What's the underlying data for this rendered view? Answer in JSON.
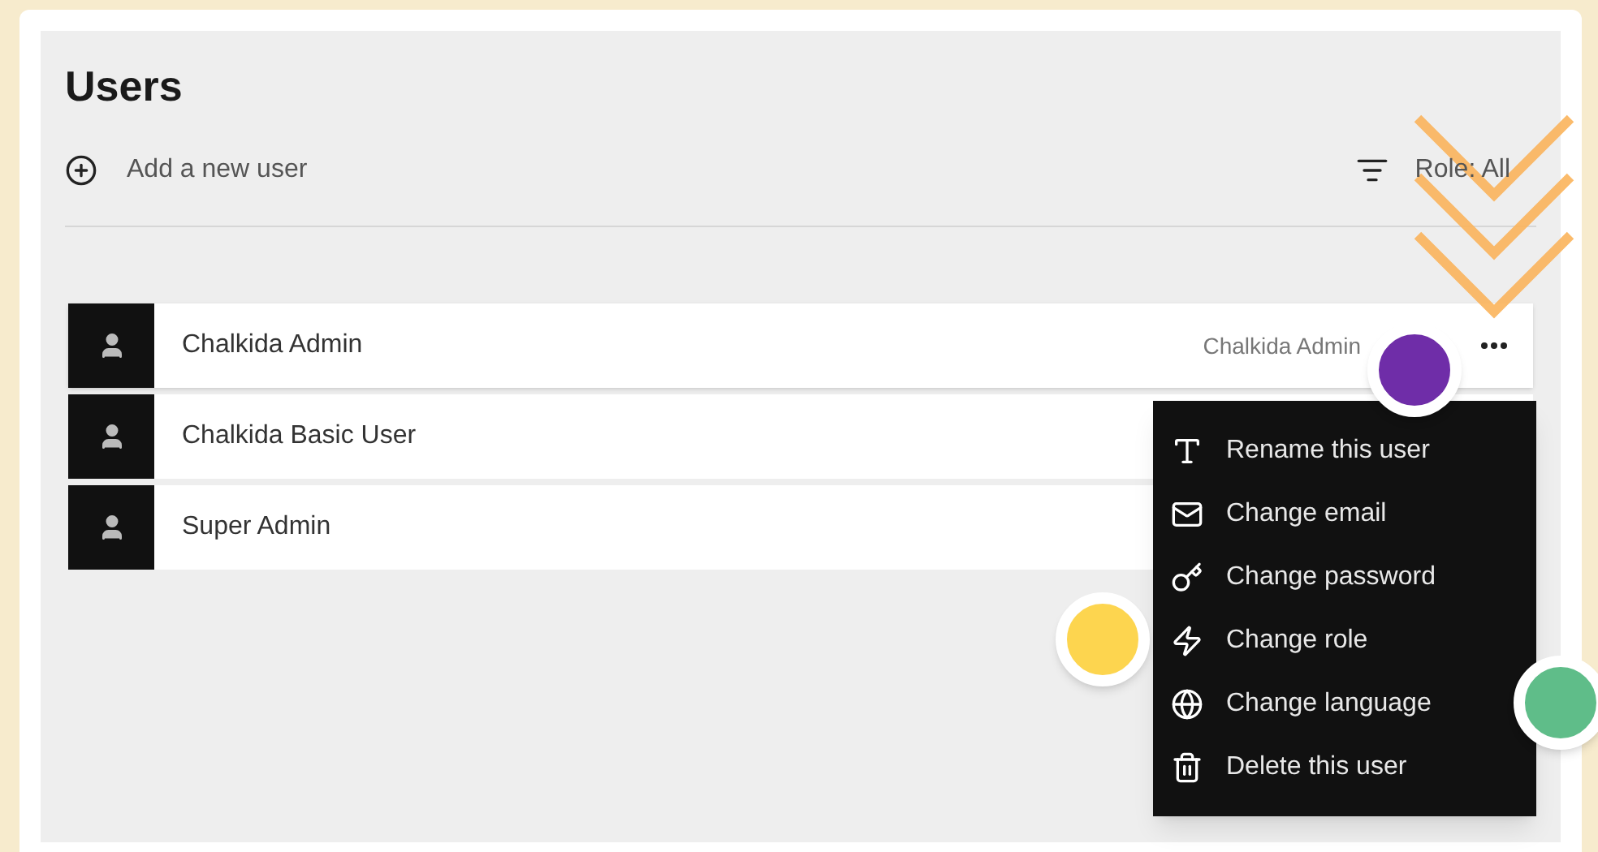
{
  "page": {
    "title": "Users"
  },
  "toolbar": {
    "add_label": "Add a new user",
    "filter_label": "Role: All"
  },
  "users": [
    {
      "name": "Chalkida Admin",
      "role": "Chalkida Admin",
      "menu_open": true
    },
    {
      "name": "Chalkida Basic User",
      "menu_open": false
    },
    {
      "name": "Super Admin",
      "menu_open": false
    }
  ],
  "context_menu": {
    "items": [
      {
        "kind": "rename",
        "label": "Rename this user"
      },
      {
        "kind": "email",
        "label": "Change email"
      },
      {
        "kind": "password",
        "label": "Change password"
      },
      {
        "kind": "role",
        "label": "Change role"
      },
      {
        "kind": "language",
        "label": "Change language"
      },
      {
        "kind": "delete",
        "label": "Delete this user"
      }
    ]
  },
  "markers": [
    {
      "color": "#6f2da8"
    },
    {
      "color": "#fdd54f"
    },
    {
      "color": "#5fbd89"
    }
  ]
}
